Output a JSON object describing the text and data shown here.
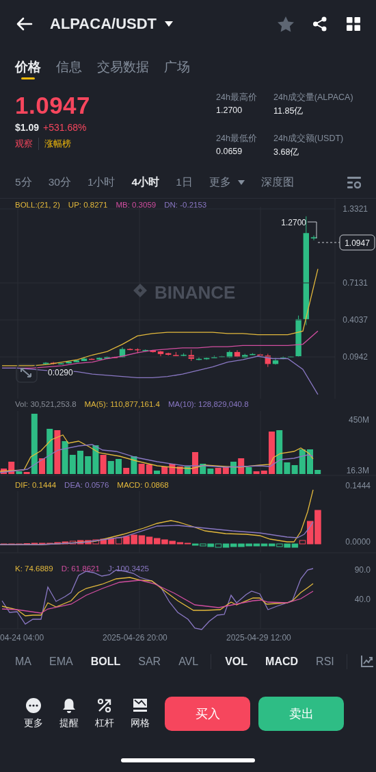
{
  "header": {
    "pair": "ALPACA/USDT",
    "favorite": false
  },
  "tabs": [
    {
      "label": "价格",
      "selected": true
    },
    {
      "label": "信息",
      "selected": false
    },
    {
      "label": "交易数据",
      "selected": false
    },
    {
      "label": "广场",
      "selected": false
    }
  ],
  "price": {
    "last": "1.0947",
    "usd": "$1.09",
    "change": "+531.68%",
    "watch": "观察",
    "ranking": "涨幅榜"
  },
  "stats": [
    {
      "label": "24h最高价",
      "value": "1.2700"
    },
    {
      "label": "24h成交量(ALPACA)",
      "value": "11.85亿"
    },
    {
      "label": "24h最低价",
      "value": "0.0659"
    },
    {
      "label": "24h成交额(USDT)",
      "value": "3.68亿"
    }
  ],
  "intervals": [
    {
      "label": "5分",
      "selected": false,
      "kind": "option"
    },
    {
      "label": "30分",
      "selected": false,
      "kind": "option"
    },
    {
      "label": "1小时",
      "selected": false,
      "kind": "option"
    },
    {
      "label": "4小时",
      "selected": true,
      "kind": "option"
    },
    {
      "label": "1日",
      "selected": false,
      "kind": "option"
    },
    {
      "label": "更多",
      "selected": false,
      "kind": "dropdown"
    },
    {
      "label": "深度图",
      "selected": false,
      "kind": "option"
    }
  ],
  "main_chart": {
    "legend": [
      {
        "text": "BOLL:(21, 2)",
        "color": "#e3b93c"
      },
      {
        "text": "UP: 0.8271",
        "color": "#e3b93c"
      },
      {
        "text": "MB: 0.3059",
        "color": "#d24ea0"
      },
      {
        "text": "DN: -0.2153",
        "color": "#8a78c4"
      }
    ],
    "chart_data": {
      "type": "line",
      "categories": [
        null,
        null,
        null,
        null,
        null,
        null,
        null,
        null,
        null,
        null,
        null,
        null,
        null,
        null,
        null,
        null,
        null,
        null,
        null,
        null,
        null,
        null
      ],
      "ylim": [
        -0.2553,
        1.418
      ],
      "grid": true,
      "yticks": [
        {
          "value": 1.3321,
          "label": "1.3321"
        },
        {
          "value": 0.7131,
          "label": "0.7131"
        },
        {
          "value": 0.4037,
          "label": "0.4037"
        },
        {
          "value": 0.0942,
          "label": "0.0942"
        }
      ],
      "series": [
        {
          "color": "#e3b93c",
          "values": [
            0.02,
            0.02,
            0.02,
            0.03,
            0.05,
            0.07,
            0.11,
            0.14,
            0.2,
            0.27,
            0.29,
            0.3,
            0.3,
            0.3,
            0.3,
            0.29,
            0.29,
            0.28,
            0.28,
            0.28,
            0.31,
            0.83
          ]
        },
        {
          "color": "#d24ea0",
          "values": [
            0,
            0,
            0,
            0.01,
            0.02,
            0.04,
            0.05,
            0.08,
            0.1,
            0.13,
            0.15,
            0.16,
            0.17,
            0.17,
            0.18,
            0.18,
            0.19,
            0.19,
            0.19,
            0.19,
            0.2,
            0.31
          ]
        },
        {
          "color": "#8a78c4",
          "values": [
            0,
            0,
            -0.01,
            -0.02,
            -0.02,
            -0.03,
            -0.05,
            -0.06,
            -0.07,
            -0.08,
            -0.08,
            -0.07,
            -0.05,
            -0.02,
            0.01,
            0.05,
            0.07,
            0.1,
            0.08,
            0.08,
            -0.01,
            -0.22
          ]
        }
      ]
    },
    "high_label": "1.2700",
    "low_label": "0.0290",
    "last_price": "1.0947",
    "logo": "BINANCE"
  },
  "volume_chart": {
    "legend": [
      {
        "text": "Vol: 30,521,253.8",
        "color": "#8a8f99"
      },
      {
        "text": "MA(5): 110,877,161.4",
        "color": "#e3b93c"
      },
      {
        "text": "MA(10): 128,829,040.8",
        "color": "#8a78c4"
      }
    ],
    "y_labels": [
      "450M",
      "16.3M"
    ]
  },
  "macd_chart": {
    "legend": [
      {
        "text": "DIF: 0.1444",
        "color": "#e3b93c"
      },
      {
        "text": "DEA: 0.0576",
        "color": "#8a78c4"
      },
      {
        "text": "MACD: 0.0868",
        "color": "#e3b93c"
      }
    ],
    "y_labels": [
      "0.1444",
      "0.0000"
    ]
  },
  "kdj_chart": {
    "legend": [
      {
        "text": "K: 74.6889",
        "color": "#e3b93c"
      },
      {
        "text": "D: 61.8621",
        "color": "#d24ea0"
      },
      {
        "text": "J: 100.3425",
        "color": "#8a78c4"
      }
    ],
    "y_labels": [
      "90.0",
      "40.0"
    ]
  },
  "time_axis": [
    "04-24 04:00",
    "2025-04-26 20:00",
    "2025-04-29 12:00"
  ],
  "indicators": {
    "main": [
      {
        "label": "MA",
        "selected": false
      },
      {
        "label": "EMA",
        "selected": false
      },
      {
        "label": "BOLL",
        "selected": true
      },
      {
        "label": "SAR",
        "selected": false
      },
      {
        "label": "AVL",
        "selected": false
      }
    ],
    "sub": [
      {
        "label": "VOL",
        "selected": true
      },
      {
        "label": "MACD",
        "selected": true
      },
      {
        "label": "RSI",
        "selected": false
      }
    ]
  },
  "toolbar": [
    {
      "label": "更多",
      "kind": "more"
    },
    {
      "label": "提醒",
      "kind": "alert"
    },
    {
      "label": "杠杆",
      "kind": "leverage"
    },
    {
      "label": "网格",
      "kind": "grid"
    }
  ],
  "buy": "买入",
  "sell": "卖出"
}
